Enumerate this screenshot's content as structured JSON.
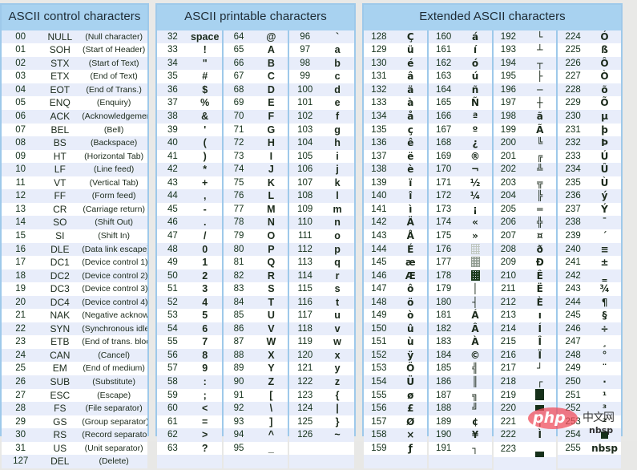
{
  "panels": {
    "control": {
      "title": "ASCII control characters",
      "rows": [
        [
          "00",
          "NULL",
          "(Null character)"
        ],
        [
          "01",
          "SOH",
          "(Start of Header)"
        ],
        [
          "02",
          "STX",
          "(Start of Text)"
        ],
        [
          "03",
          "ETX",
          "(End of Text)"
        ],
        [
          "04",
          "EOT",
          "(End of Trans.)"
        ],
        [
          "05",
          "ENQ",
          "(Enquiry)"
        ],
        [
          "06",
          "ACK",
          "(Acknowledgement)"
        ],
        [
          "07",
          "BEL",
          "(Bell)"
        ],
        [
          "08",
          "BS",
          "(Backspace)"
        ],
        [
          "09",
          "HT",
          "(Horizontal Tab)"
        ],
        [
          "10",
          "LF",
          "(Line feed)"
        ],
        [
          "11",
          "VT",
          "(Vertical Tab)"
        ],
        [
          "12",
          "FF",
          "(Form feed)"
        ],
        [
          "13",
          "CR",
          "(Carriage return)"
        ],
        [
          "14",
          "SO",
          "(Shift Out)"
        ],
        [
          "15",
          "SI",
          "(Shift In)"
        ],
        [
          "16",
          "DLE",
          "(Data link escape)"
        ],
        [
          "17",
          "DC1",
          "(Device control 1)"
        ],
        [
          "18",
          "DC2",
          "(Device control 2)"
        ],
        [
          "19",
          "DC3",
          "(Device control 3)"
        ],
        [
          "20",
          "DC4",
          "(Device control 4)"
        ],
        [
          "21",
          "NAK",
          "(Negative acknowl.)"
        ],
        [
          "22",
          "SYN",
          "(Synchronous idle)"
        ],
        [
          "23",
          "ETB",
          "(End of trans. block)"
        ],
        [
          "24",
          "CAN",
          "(Cancel)"
        ],
        [
          "25",
          "EM",
          "(End of medium)"
        ],
        [
          "26",
          "SUB",
          "(Substitute)"
        ],
        [
          "27",
          "ESC",
          "(Escape)"
        ],
        [
          "28",
          "FS",
          "(File separator)"
        ],
        [
          "29",
          "GS",
          "(Group separator)"
        ],
        [
          "30",
          "RS",
          "(Record separator)"
        ],
        [
          "31",
          "US",
          "(Unit separator)"
        ],
        [
          "127",
          "DEL",
          "(Delete)"
        ]
      ]
    },
    "printable": {
      "title": "ASCII printable characters",
      "columns": [
        [
          [
            "32",
            "space"
          ],
          [
            "33",
            "!"
          ],
          [
            "34",
            "\""
          ],
          [
            "35",
            "#"
          ],
          [
            "36",
            "$"
          ],
          [
            "37",
            "%"
          ],
          [
            "38",
            "&"
          ],
          [
            "39",
            "'"
          ],
          [
            "40",
            "("
          ],
          [
            "41",
            ")"
          ],
          [
            "42",
            "*"
          ],
          [
            "43",
            "+"
          ],
          [
            "44",
            ","
          ],
          [
            "45",
            "-"
          ],
          [
            "46",
            "."
          ],
          [
            "47",
            "/"
          ],
          [
            "48",
            "0"
          ],
          [
            "49",
            "1"
          ],
          [
            "50",
            "2"
          ],
          [
            "51",
            "3"
          ],
          [
            "52",
            "4"
          ],
          [
            "53",
            "5"
          ],
          [
            "54",
            "6"
          ],
          [
            "55",
            "7"
          ],
          [
            "56",
            "8"
          ],
          [
            "57",
            "9"
          ],
          [
            "58",
            ":"
          ],
          [
            "59",
            ";"
          ],
          [
            "60",
            "<"
          ],
          [
            "61",
            "="
          ],
          [
            "62",
            ">"
          ],
          [
            "63",
            "?"
          ]
        ],
        [
          [
            "64",
            "@"
          ],
          [
            "65",
            "A"
          ],
          [
            "66",
            "B"
          ],
          [
            "67",
            "C"
          ],
          [
            "68",
            "D"
          ],
          [
            "69",
            "E"
          ],
          [
            "70",
            "F"
          ],
          [
            "71",
            "G"
          ],
          [
            "72",
            "H"
          ],
          [
            "73",
            "I"
          ],
          [
            "74",
            "J"
          ],
          [
            "75",
            "K"
          ],
          [
            "76",
            "L"
          ],
          [
            "77",
            "M"
          ],
          [
            "78",
            "N"
          ],
          [
            "79",
            "O"
          ],
          [
            "80",
            "P"
          ],
          [
            "81",
            "Q"
          ],
          [
            "82",
            "R"
          ],
          [
            "83",
            "S"
          ],
          [
            "84",
            "T"
          ],
          [
            "85",
            "U"
          ],
          [
            "86",
            "V"
          ],
          [
            "87",
            "W"
          ],
          [
            "88",
            "X"
          ],
          [
            "89",
            "Y"
          ],
          [
            "90",
            "Z"
          ],
          [
            "91",
            "["
          ],
          [
            "92",
            "\\"
          ],
          [
            "93",
            "]"
          ],
          [
            "94",
            "^"
          ],
          [
            "95",
            "_"
          ]
        ],
        [
          [
            "96",
            "`"
          ],
          [
            "97",
            "a"
          ],
          [
            "98",
            "b"
          ],
          [
            "99",
            "c"
          ],
          [
            "100",
            "d"
          ],
          [
            "101",
            "e"
          ],
          [
            "102",
            "f"
          ],
          [
            "103",
            "g"
          ],
          [
            "104",
            "h"
          ],
          [
            "105",
            "i"
          ],
          [
            "106",
            "j"
          ],
          [
            "107",
            "k"
          ],
          [
            "108",
            "l"
          ],
          [
            "109",
            "m"
          ],
          [
            "110",
            "n"
          ],
          [
            "111",
            "o"
          ],
          [
            "112",
            "p"
          ],
          [
            "113",
            "q"
          ],
          [
            "114",
            "r"
          ],
          [
            "115",
            "s"
          ],
          [
            "116",
            "t"
          ],
          [
            "117",
            "u"
          ],
          [
            "118",
            "v"
          ],
          [
            "119",
            "w"
          ],
          [
            "120",
            "x"
          ],
          [
            "121",
            "y"
          ],
          [
            "122",
            "z"
          ],
          [
            "123",
            "{"
          ],
          [
            "124",
            "|"
          ],
          [
            "125",
            "}"
          ],
          [
            "126",
            "~"
          ]
        ]
      ]
    },
    "extended": {
      "title": "Extended ASCII characters",
      "columns": [
        [
          [
            "128",
            "Ç"
          ],
          [
            "129",
            "ü"
          ],
          [
            "130",
            "é"
          ],
          [
            "131",
            "â"
          ],
          [
            "132",
            "ä"
          ],
          [
            "133",
            "à"
          ],
          [
            "134",
            "å"
          ],
          [
            "135",
            "ç"
          ],
          [
            "136",
            "ê"
          ],
          [
            "137",
            "ë"
          ],
          [
            "138",
            "è"
          ],
          [
            "139",
            "ï"
          ],
          [
            "140",
            "î"
          ],
          [
            "141",
            "ì"
          ],
          [
            "142",
            "Ä"
          ],
          [
            "143",
            "Å"
          ],
          [
            "144",
            "É"
          ],
          [
            "145",
            "æ"
          ],
          [
            "146",
            "Æ"
          ],
          [
            "147",
            "ô"
          ],
          [
            "148",
            "ö"
          ],
          [
            "149",
            "ò"
          ],
          [
            "150",
            "û"
          ],
          [
            "151",
            "ù"
          ],
          [
            "152",
            "ÿ"
          ],
          [
            "153",
            "Ö"
          ],
          [
            "154",
            "Ü"
          ],
          [
            "155",
            "ø"
          ],
          [
            "156",
            "£"
          ],
          [
            "157",
            "Ø"
          ],
          [
            "158",
            "×"
          ],
          [
            "159",
            "ƒ"
          ]
        ],
        [
          [
            "160",
            "á"
          ],
          [
            "161",
            "í"
          ],
          [
            "162",
            "ó"
          ],
          [
            "163",
            "ú"
          ],
          [
            "164",
            "ñ"
          ],
          [
            "165",
            "Ñ"
          ],
          [
            "166",
            "ª"
          ],
          [
            "167",
            "º"
          ],
          [
            "168",
            "¿"
          ],
          [
            "169",
            "®"
          ],
          [
            "170",
            "¬"
          ],
          [
            "171",
            "½"
          ],
          [
            "172",
            "¼"
          ],
          [
            "173",
            "¡"
          ],
          [
            "174",
            "«"
          ],
          [
            "175",
            "»"
          ],
          [
            "176",
            "░"
          ],
          [
            "177",
            "▒"
          ],
          [
            "178",
            "▓"
          ],
          [
            "179",
            "│"
          ],
          [
            "180",
            "┤"
          ],
          [
            "181",
            "Á"
          ],
          [
            "182",
            "Â"
          ],
          [
            "183",
            "À"
          ],
          [
            "184",
            "©"
          ],
          [
            "185",
            "╣"
          ],
          [
            "186",
            "║"
          ],
          [
            "187",
            "╗"
          ],
          [
            "188",
            "╝"
          ],
          [
            "189",
            "¢"
          ],
          [
            "190",
            "¥"
          ],
          [
            "191",
            "┐"
          ]
        ],
        [
          [
            "192",
            "└"
          ],
          [
            "193",
            "┴"
          ],
          [
            "194",
            "┬"
          ],
          [
            "195",
            "├"
          ],
          [
            "196",
            "─"
          ],
          [
            "197",
            "┼"
          ],
          [
            "198",
            "ã"
          ],
          [
            "199",
            "Ã"
          ],
          [
            "200",
            "╚"
          ],
          [
            "201",
            "╔"
          ],
          [
            "202",
            "╩"
          ],
          [
            "203",
            "╦"
          ],
          [
            "204",
            "╠"
          ],
          [
            "205",
            "═"
          ],
          [
            "206",
            "╬"
          ],
          [
            "207",
            "¤"
          ],
          [
            "208",
            "ð"
          ],
          [
            "209",
            "Ð"
          ],
          [
            "210",
            "Ê"
          ],
          [
            "211",
            "Ë"
          ],
          [
            "212",
            "È"
          ],
          [
            "213",
            "ı"
          ],
          [
            "214",
            "Í"
          ],
          [
            "215",
            "Î"
          ],
          [
            "216",
            "Ï"
          ],
          [
            "217",
            "┘"
          ],
          [
            "218",
            "┌"
          ],
          [
            "219",
            "█"
          ],
          [
            "220",
            "▄"
          ],
          [
            "221",
            "¦"
          ],
          [
            "222",
            "Ì"
          ],
          [
            "223",
            "▀"
          ]
        ],
        [
          [
            "224",
            "Ó"
          ],
          [
            "225",
            "ß"
          ],
          [
            "226",
            "Ô"
          ],
          [
            "227",
            "Ò"
          ],
          [
            "228",
            "õ"
          ],
          [
            "229",
            "Õ"
          ],
          [
            "230",
            "µ"
          ],
          [
            "231",
            "þ"
          ],
          [
            "232",
            "Þ"
          ],
          [
            "233",
            "Ú"
          ],
          [
            "234",
            "Û"
          ],
          [
            "235",
            "Ù"
          ],
          [
            "236",
            "ý"
          ],
          [
            "237",
            "Ý"
          ],
          [
            "238",
            "¯"
          ],
          [
            "239",
            "´"
          ],
          [
            "240",
            "≡"
          ],
          [
            "241",
            "±"
          ],
          [
            "242",
            "‗"
          ],
          [
            "243",
            "¾"
          ],
          [
            "244",
            "¶"
          ],
          [
            "245",
            "§"
          ],
          [
            "246",
            "÷"
          ],
          [
            "247",
            "¸"
          ],
          [
            "248",
            "°"
          ],
          [
            "249",
            "¨"
          ],
          [
            "250",
            "·"
          ],
          [
            "251",
            "¹"
          ],
          [
            "252",
            "³"
          ],
          [
            "253",
            "²"
          ],
          [
            "254",
            "■"
          ],
          [
            "255",
            "nbsp"
          ]
        ]
      ]
    }
  },
  "watermark": {
    "brand": "php",
    "cn": "中文网",
    "nbsp": "nbsp"
  }
}
